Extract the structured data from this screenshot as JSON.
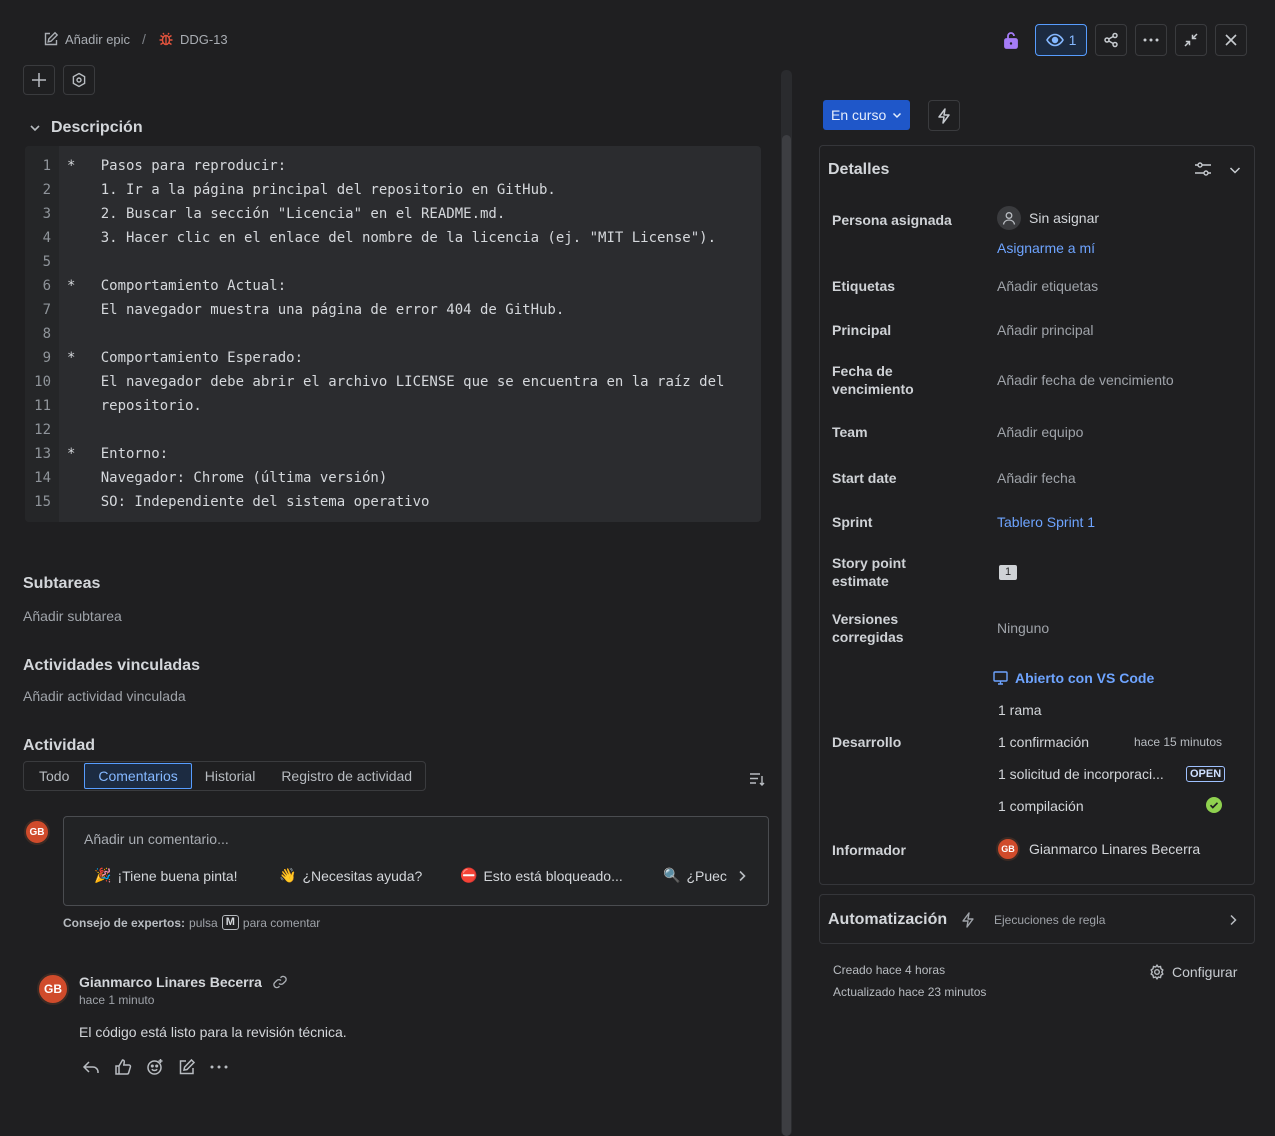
{
  "header": {
    "add_epic": "Añadir epic",
    "separator": "/",
    "issue_key": "DDG-13",
    "watch_count": "1"
  },
  "description": {
    "title": "Descripción",
    "lines": [
      {
        "n": "1",
        "text": "*   Pasos para reproducir:"
      },
      {
        "n": "2",
        "text": "    1. Ir a la página principal del repositorio en GitHub."
      },
      {
        "n": "3",
        "text": "    2. Buscar la sección \"Licencia\" en el README.md."
      },
      {
        "n": "4",
        "text": "    3. Hacer clic en el enlace del nombre de la licencia (ej. \"MIT License\")."
      },
      {
        "n": "5",
        "text": ""
      },
      {
        "n": "6",
        "text": "*   Comportamiento Actual:"
      },
      {
        "n": "7",
        "text": "    El navegador muestra una página de error 404 de GitHub."
      },
      {
        "n": "8",
        "text": ""
      },
      {
        "n": "9",
        "text": "*   Comportamiento Esperado:"
      },
      {
        "n": "10",
        "text": "    El navegador debe abrir el archivo LICENSE que se encuentra en la raíz del"
      },
      {
        "n": "11",
        "text": "    repositorio."
      },
      {
        "n": "12",
        "text": ""
      },
      {
        "n": "13",
        "text": "*   Entorno:"
      },
      {
        "n": "14",
        "text": "    Navegador: Chrome (última versión)"
      },
      {
        "n": "15",
        "text": "    SO: Independiente del sistema operativo"
      }
    ]
  },
  "subtasks": {
    "title": "Subtareas",
    "add": "Añadir subtarea"
  },
  "linked": {
    "title": "Actividades vinculadas",
    "add": "Añadir actividad vinculada"
  },
  "activity": {
    "title": "Actividad",
    "tabs": [
      "Todo",
      "Comentarios",
      "Historial",
      "Registro de actividad"
    ],
    "active_tab": "Comentarios"
  },
  "comment_editor": {
    "avatar": "GB",
    "placeholder": "Añadir un comentario...",
    "chips": [
      {
        "emoji": "🎉",
        "label": "¡Tiene buena pinta!"
      },
      {
        "emoji": "👋",
        "label": "¿Necesitas ayuda?"
      },
      {
        "emoji": "⛔",
        "label": "Esto está bloqueado..."
      },
      {
        "emoji": "🔍",
        "label": "¿Puec"
      }
    ],
    "tip_bold": "Consejo de expertos:",
    "tip_pre": "pulsa",
    "tip_key": "M",
    "tip_post": "para comentar"
  },
  "comment": {
    "avatar": "GB",
    "author": "Gianmarco Linares Becerra",
    "time": "hace 1 minuto",
    "body": "El código está listo para la revisión técnica."
  },
  "status": {
    "label": "En curso"
  },
  "details": {
    "title": "Detalles",
    "assignee_label": "Persona asignada",
    "assignee_value": "Sin asignar",
    "assign_me": "Asignarme a mí",
    "labels_label": "Etiquetas",
    "labels_value": "Añadir etiquetas",
    "parent_label": "Principal",
    "parent_value": "Añadir principal",
    "due_label": "Fecha de vencimiento",
    "due_value": "Añadir fecha de vencimiento",
    "team_label": "Team",
    "team_value": "Añadir equipo",
    "start_label": "Start date",
    "start_value": "Añadir fecha",
    "sprint_label": "Sprint",
    "sprint_value": "Tablero Sprint 1",
    "sp_label": "Story point estimate",
    "sp_value": "1",
    "fixver_label": "Versiones corregidas",
    "fixver_value": "Ninguno",
    "dev_label": "Desarrollo",
    "vscode": "Abierto con VS Code",
    "branch": "1 rama",
    "commit": "1 confirmación",
    "commit_time": "hace 15 minutos",
    "pr": "1 solicitud de incorporaci...",
    "pr_status": "OPEN",
    "build": "1 compilación",
    "reporter_label": "Informador",
    "reporter_avatar": "GB",
    "reporter_name": "Gianmarco Linares Becerra"
  },
  "automation": {
    "title": "Automatización",
    "rules": "Ejecuciones de regla"
  },
  "footer": {
    "created": "Creado hace 4 horas",
    "updated": "Actualizado hace 23 minutos",
    "configure": "Configurar"
  }
}
